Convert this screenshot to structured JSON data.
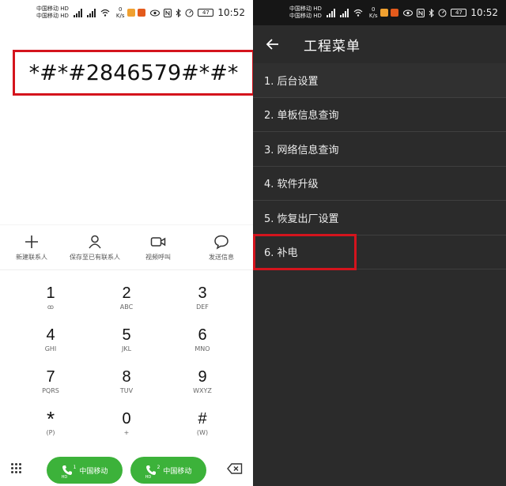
{
  "left": {
    "status": {
      "carrier1": "中国移动",
      "carrier2": "中国移动",
      "hd1": "HD",
      "hd2": "HD",
      "speed_value": "0",
      "speed_unit": "K/s",
      "battery": "47",
      "time": "10:52"
    },
    "dial_number": "*#*#2846579#*#*",
    "actions": [
      {
        "label": "新建联系人",
        "icon": "plus-icon"
      },
      {
        "label": "保存至已有联系人",
        "icon": "person-icon"
      },
      {
        "label": "视频呼叫",
        "icon": "video-camera-icon"
      },
      {
        "label": "发送信息",
        "icon": "message-bubble-icon"
      }
    ],
    "keys": [
      {
        "digit": "1",
        "letters": "ꝏ"
      },
      {
        "digit": "2",
        "letters": "ABC"
      },
      {
        "digit": "3",
        "letters": "DEF"
      },
      {
        "digit": "4",
        "letters": "GHI"
      },
      {
        "digit": "5",
        "letters": "JKL"
      },
      {
        "digit": "6",
        "letters": "MNO"
      },
      {
        "digit": "7",
        "letters": "PQRS"
      },
      {
        "digit": "8",
        "letters": "TUV"
      },
      {
        "digit": "9",
        "letters": "WXYZ"
      },
      {
        "digit": "*",
        "letters": "(P)"
      },
      {
        "digit": "0",
        "letters": "+"
      },
      {
        "digit": "#",
        "letters": "(W)"
      }
    ],
    "call_buttons": [
      {
        "label": "中国移动",
        "sim": "1",
        "hd": "HD"
      },
      {
        "label": "中国移动",
        "sim": "2",
        "hd": "HD"
      }
    ]
  },
  "right": {
    "status": {
      "carrier1": "中国移动",
      "carrier2": "中国移动",
      "hd1": "HD",
      "hd2": "HD",
      "speed_value": "0",
      "speed_unit": "K/s",
      "battery": "47",
      "time": "10:52"
    },
    "title": "工程菜单",
    "menu_items": [
      "1. 后台设置",
      "2. 单板信息查询",
      "3. 网络信息查询",
      "4. 软件升级",
      "5. 恢复出厂设置",
      "6. 补电"
    ]
  },
  "colors": {
    "highlight_red": "#d4141d",
    "call_green": "#3cb23a",
    "menu_bg": "#2b2b2b"
  }
}
